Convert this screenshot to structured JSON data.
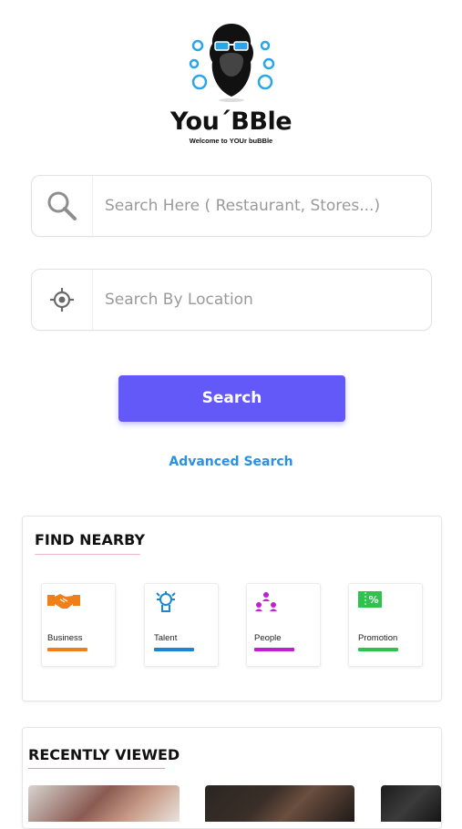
{
  "brand": {
    "name": "You´BBle",
    "tagline": "Welcome to YOUr buBBle"
  },
  "search": {
    "placeholder": "Search Here ( Restaurant, Stores...)"
  },
  "location": {
    "placeholder": "Search By Location"
  },
  "search_button": "Search",
  "advanced_search": "Advanced Search",
  "find_nearby": {
    "title": "FIND NEARBY",
    "items": [
      {
        "label": "Business",
        "icon": "handshake-icon",
        "color": "#f07f17"
      },
      {
        "label": "Talent",
        "icon": "talent-icon",
        "color": "#1a86d8"
      },
      {
        "label": "People",
        "icon": "people-icon",
        "color": "#c21fd4"
      },
      {
        "label": "Promotion",
        "icon": "coupon-icon",
        "color": "#2ec34f"
      }
    ]
  },
  "recently_viewed": {
    "title": "RECENTLY VIEWED"
  },
  "colors": {
    "accent": "#6359f8",
    "link": "#2d8fe0"
  }
}
